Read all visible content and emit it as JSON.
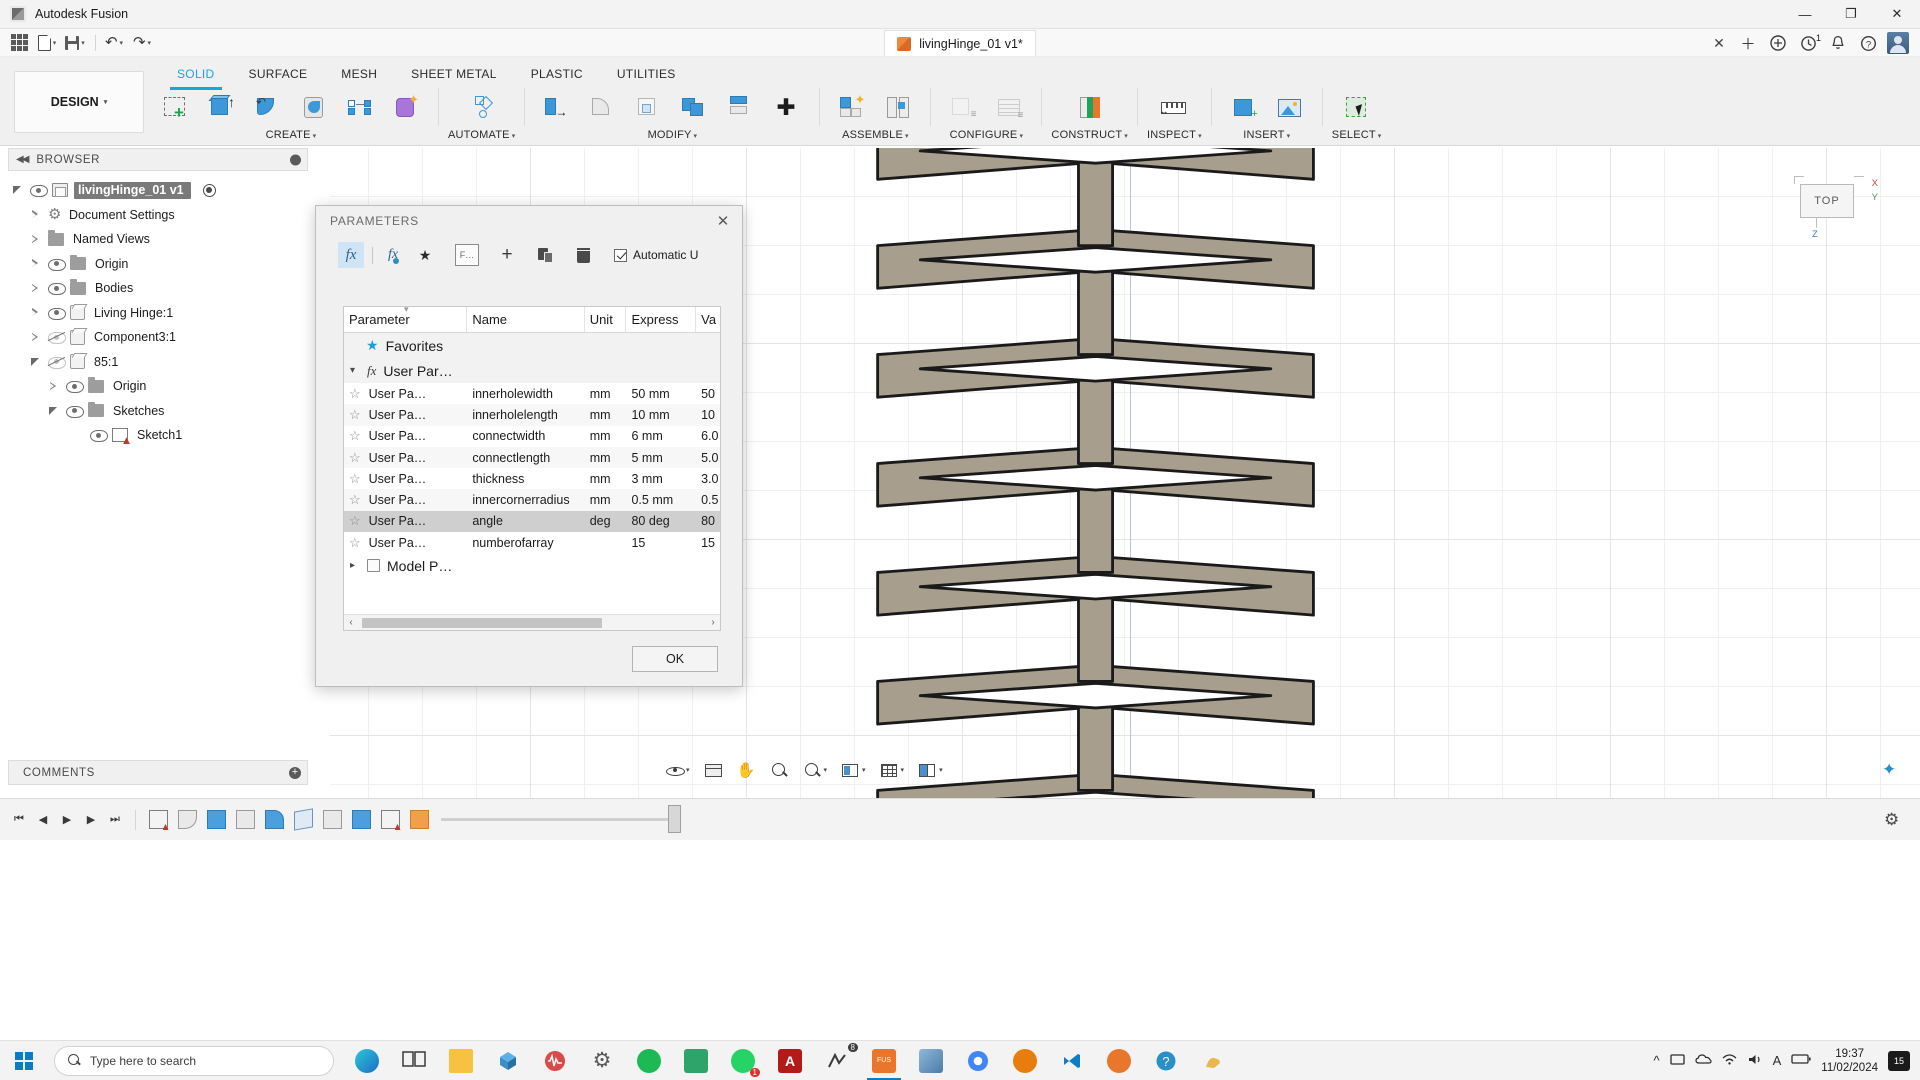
{
  "titlebar": {
    "app_title": "Autodesk Fusion",
    "minimize": "—",
    "maximize": "❐",
    "close": "✕"
  },
  "quick_access": {
    "grid_icon": "grid-icon",
    "new_icon": "new-document-icon",
    "save_icon": "save-icon",
    "undo_icon": "undo-icon",
    "redo_icon": "redo-icon",
    "caret": "▾"
  },
  "doctab": {
    "label": "livingHinge_01 v1*",
    "close": "✕",
    "add": "＋",
    "notification_count": "1",
    "help": "?"
  },
  "ribbon": {
    "design_label": "DESIGN",
    "design_caret": "▾",
    "tabs": [
      {
        "label": "SOLID",
        "active": true
      },
      {
        "label": "SURFACE",
        "active": false
      },
      {
        "label": "MESH",
        "active": false
      },
      {
        "label": "SHEET METAL",
        "active": false
      },
      {
        "label": "PLASTIC",
        "active": false
      },
      {
        "label": "UTILITIES",
        "active": false
      }
    ],
    "groups": [
      {
        "label": "CREATE",
        "caret": "▾"
      },
      {
        "label": "AUTOMATE",
        "caret": "▾"
      },
      {
        "label": "MODIFY",
        "caret": "▾"
      },
      {
        "label": "ASSEMBLE",
        "caret": "▾"
      },
      {
        "label": "CONFIGURE",
        "caret": "▾"
      },
      {
        "label": "CONSTRUCT",
        "caret": "▾"
      },
      {
        "label": "INSPECT",
        "caret": "▾"
      },
      {
        "label": "INSERT",
        "caret": "▾"
      },
      {
        "label": "SELECT",
        "caret": "▾"
      }
    ]
  },
  "browser": {
    "title": "BROWSER",
    "items": [
      {
        "label": "livingHinge_01 v1",
        "icon": "component-icon",
        "indent": 0,
        "selected": true,
        "expander": "down",
        "eye": "on"
      },
      {
        "label": "Document Settings",
        "icon": "gear-icon",
        "indent": 1,
        "selected": false,
        "expander": "right",
        "eye": "none"
      },
      {
        "label": "Named Views",
        "icon": "folder-icon",
        "indent": 1,
        "selected": false,
        "expander": "right",
        "eye": "none"
      },
      {
        "label": "Origin",
        "icon": "folder-icon",
        "indent": 1,
        "selected": false,
        "expander": "right",
        "eye": "on"
      },
      {
        "label": "Bodies",
        "icon": "folder-icon",
        "indent": 1,
        "selected": false,
        "expander": "right",
        "eye": "on"
      },
      {
        "label": "Living Hinge:1",
        "icon": "body-icon",
        "indent": 1,
        "selected": false,
        "expander": "right",
        "eye": "on"
      },
      {
        "label": "Component3:1",
        "icon": "body-icon",
        "indent": 1,
        "selected": false,
        "expander": "right",
        "eye": "off"
      },
      {
        "label": "85:1",
        "icon": "body-icon",
        "indent": 1,
        "selected": false,
        "expander": "down",
        "eye": "off"
      },
      {
        "label": "Origin",
        "icon": "folder-icon",
        "indent": 2,
        "selected": false,
        "expander": "right",
        "eye": "on"
      },
      {
        "label": "Sketches",
        "icon": "folder-icon",
        "indent": 2,
        "selected": false,
        "expander": "down",
        "eye": "on"
      },
      {
        "label": "Sketch1",
        "icon": "sketch-icon",
        "indent": 3,
        "selected": false,
        "expander": "none",
        "eye": "on"
      }
    ]
  },
  "comments": {
    "title": "COMMENTS",
    "add": "+"
  },
  "viewcube": {
    "face": "TOP",
    "x": "X",
    "y": "Y",
    "z": "Z"
  },
  "navbar": {
    "orbit": "orbit-icon",
    "display": "display-settings-icon",
    "pan": "pan-hand-icon",
    "zoom": "zoom-icon",
    "fit": "zoom-fit-icon",
    "display_style": "display-style-icon",
    "grid": "grid-snap-icon",
    "layout": "viewport-layout-icon",
    "caret": "▾"
  },
  "parameters_dialog": {
    "title": "PARAMETERS",
    "close": "✕",
    "toolbar": {
      "fx_label": "fx",
      "fx_user_label": "fx",
      "star_label": "★",
      "filter_label": "F…",
      "add_label": "+",
      "duplicate_label": "duplicate-icon",
      "delete_label": "delete-icon",
      "auto_update_label": "Automatic U"
    },
    "columns": [
      "Parameter",
      "Name",
      "Unit",
      "Express",
      "Va"
    ],
    "groups": {
      "favorites": "Favorites",
      "user_parameters": "User Par…",
      "model_parameters": "Model P…"
    },
    "rows": [
      {
        "parameter": "User Pa…",
        "name": "innerholewidth",
        "unit": "mm",
        "expression": "50 mm",
        "value": "50"
      },
      {
        "parameter": "User Pa…",
        "name": "innerholelength",
        "unit": "mm",
        "expression": "10 mm",
        "value": "10"
      },
      {
        "parameter": "User Pa…",
        "name": "connectwidth",
        "unit": "mm",
        "expression": "6 mm",
        "value": "6.0"
      },
      {
        "parameter": "User Pa…",
        "name": "connectlength",
        "unit": "mm",
        "expression": "5 mm",
        "value": "5.0"
      },
      {
        "parameter": "User Pa…",
        "name": "thickness",
        "unit": "mm",
        "expression": "3 mm",
        "value": "3.0"
      },
      {
        "parameter": "User Pa…",
        "name": "innercornerradius",
        "unit": "mm",
        "expression": "0.5 mm",
        "value": "0.5"
      },
      {
        "parameter": "User Pa…",
        "name": "angle",
        "unit": "deg",
        "expression": "80 deg",
        "value": "80"
      },
      {
        "parameter": "User Pa…",
        "name": "numberofarray",
        "unit": "",
        "expression": "15",
        "value": "15"
      }
    ],
    "ok_label": "OK",
    "scroll_left": "‹",
    "scroll_right": "›"
  },
  "timeline": {
    "first": "⏮",
    "prev": "◀",
    "play": "▶",
    "next": "▶",
    "last": "⏭",
    "features": [
      "sketch-feature-icon",
      "revolve-feature-icon",
      "extrude-feature-icon",
      "shell-feature-icon",
      "fillet-feature-icon",
      "plane-feature-icon",
      "pattern-feature-icon",
      "combine-feature-icon",
      "sketch2-feature-icon",
      "extrude2-feature-icon"
    ],
    "settings": "⚙"
  },
  "taskbar": {
    "search_placeholder": "Type here to search",
    "apps": [
      {
        "name": "edge-app",
        "color": "#1a8ac4"
      },
      {
        "name": "task-view-app",
        "color": "#4a4a4a"
      },
      {
        "name": "explorer-app",
        "color": "#f5c242"
      },
      {
        "name": "store-app",
        "color": "#4aa3df"
      },
      {
        "name": "audacity-app",
        "color": "#d94a4a"
      },
      {
        "name": "settings-app",
        "color": "#6a6a6a"
      },
      {
        "name": "spotify-app",
        "color": "#1db954"
      },
      {
        "name": "lbry-app",
        "color": "#2fa46a"
      },
      {
        "name": "whatsapp-app",
        "color": "#25d366",
        "badge": "1"
      },
      {
        "name": "adobe-app",
        "color": "#d9272e"
      },
      {
        "name": "sketchup-app",
        "color": "#3d3d3d",
        "badge": "8"
      },
      {
        "name": "fusion-app",
        "color": "#e8762c",
        "active": true
      },
      {
        "name": "kdenlive-app",
        "color": "#5a8ab8"
      },
      {
        "name": "chrome-app",
        "color": "#4285f4"
      },
      {
        "name": "blender-app",
        "color": "#e87d0d"
      },
      {
        "name": "vscode-app",
        "color": "#0b7ec4"
      },
      {
        "name": "tool-app",
        "color": "#e8762c"
      },
      {
        "name": "help-app",
        "color": "#2b8fc7"
      },
      {
        "name": "paint-app",
        "color": "#e8b84a"
      }
    ],
    "tray": {
      "chevron": "^",
      "clock_time": "19:37",
      "clock_date": "11/02/2024",
      "notif_count": "15"
    }
  }
}
